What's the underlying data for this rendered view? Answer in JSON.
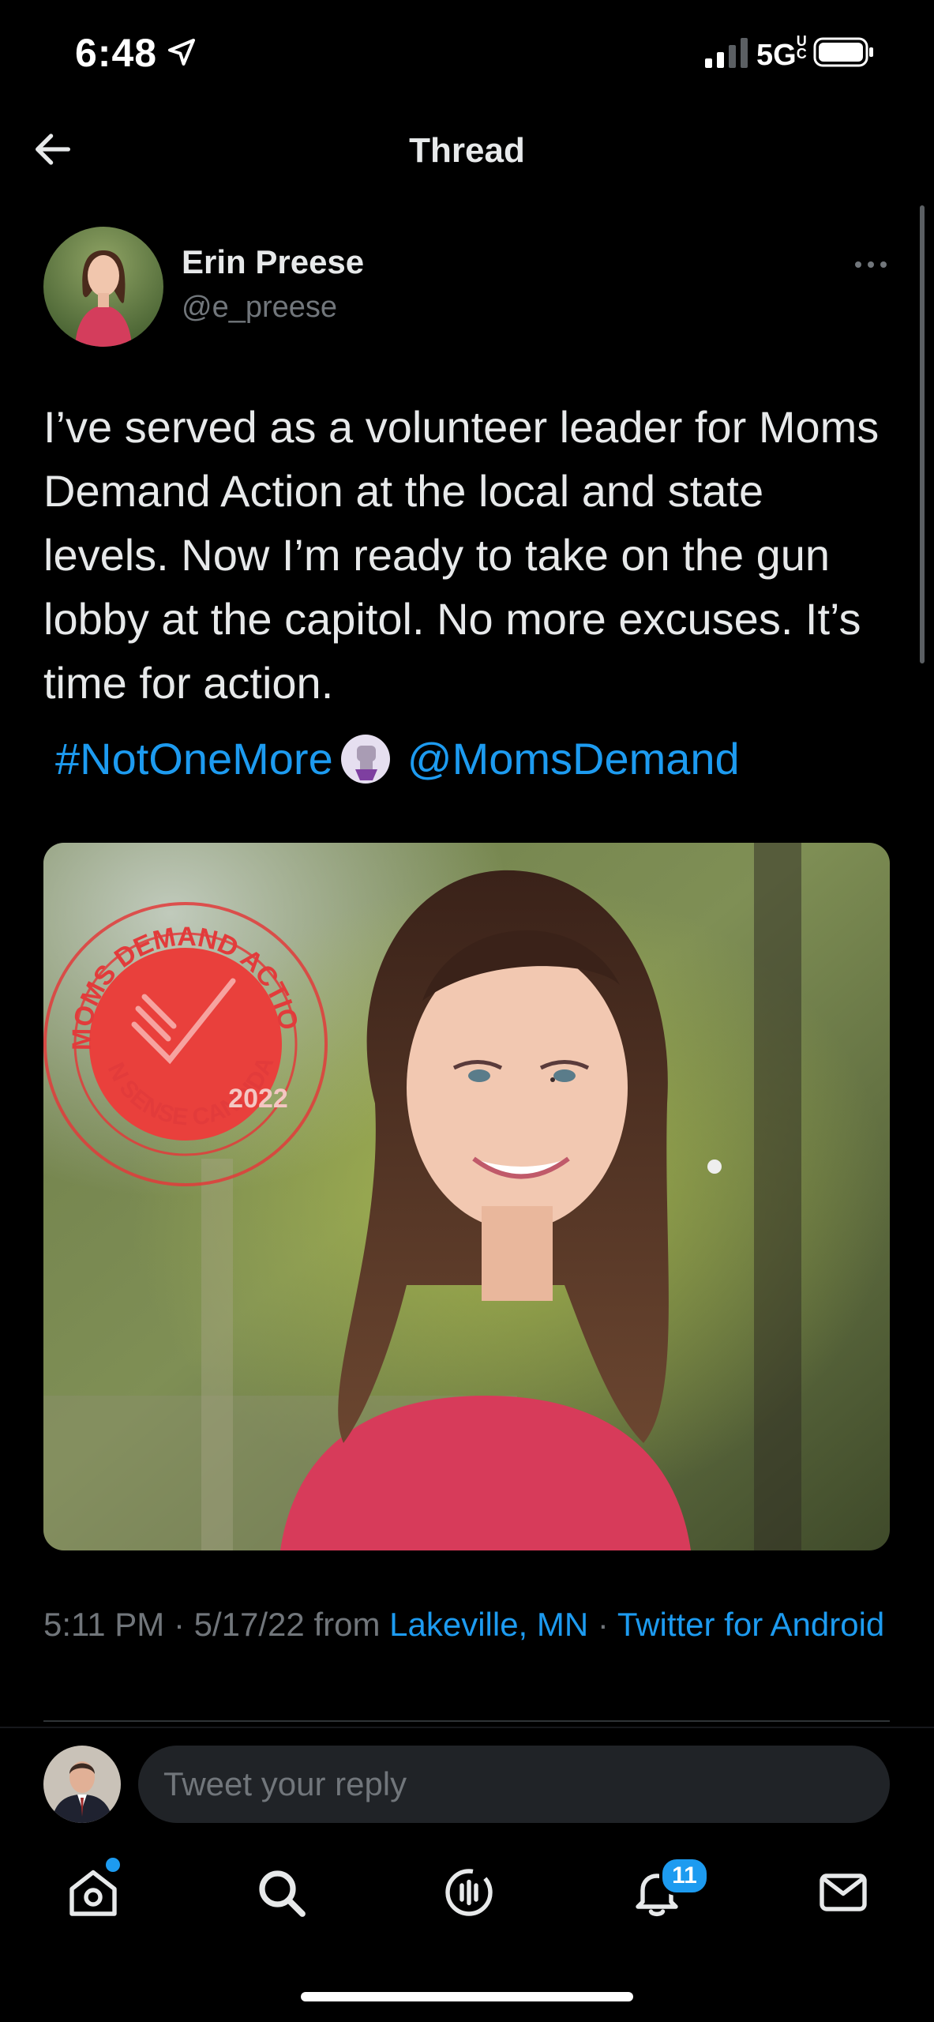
{
  "status_bar": {
    "time": "6:48",
    "network": "5G",
    "network_sup": "UC"
  },
  "header": {
    "title": "Thread"
  },
  "tweet": {
    "author_name": "Erin Preese",
    "author_handle": "@e_preese",
    "text": "I’ve served as a volunteer leader for Moms Demand Action at the local and state levels. Now I’m ready to take on the gun lobby at the capitol. No more excuses. It’s time for action.",
    "hashtag": "#NotOneMore",
    "mention": "@MomsDemand",
    "image": {
      "seal_top_text": "MOMS DEMAND ACTION",
      "seal_bottom_text": "GUN SENSE CANDIDATE",
      "seal_year": "2022"
    },
    "meta": {
      "time": "5:11 PM",
      "date": "5/17/22",
      "from": "from",
      "location": "Lakeville, MN",
      "client": "Twitter for Android",
      "sep": "·"
    }
  },
  "reply": {
    "placeholder": "Tweet your reply"
  },
  "nav": {
    "items": [
      {
        "name": "home",
        "icon": "home-icon"
      },
      {
        "name": "search",
        "icon": "search-icon"
      },
      {
        "name": "spaces",
        "icon": "spaces-icon"
      },
      {
        "name": "notifications",
        "icon": "bell-icon"
      },
      {
        "name": "messages",
        "icon": "mail-icon"
      }
    ],
    "notifications_count": "11"
  },
  "colors": {
    "accent": "#1d9bf0",
    "background": "#000000",
    "secondary_text": "#71767b"
  }
}
